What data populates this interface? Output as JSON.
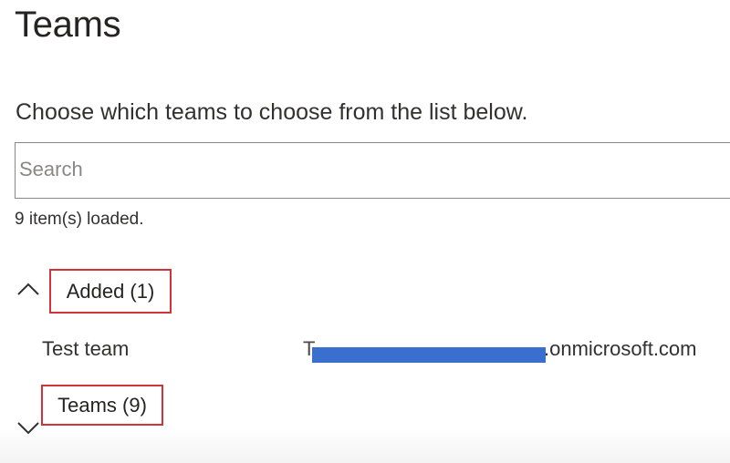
{
  "page": {
    "title": "Teams",
    "description": "Choose which teams to choose from the list below."
  },
  "search": {
    "placeholder": "Search",
    "value": ""
  },
  "status": {
    "loaded_text": "9 item(s) loaded."
  },
  "sections": {
    "added": {
      "label": "Added (1)",
      "expanded": true,
      "chevron_icon": "chevron-up-icon",
      "items": [
        {
          "name": "Test team",
          "email_visible": ".onmicrosoft.com",
          "email_obscured": "T"
        }
      ]
    },
    "teams": {
      "label": "Teams (9)",
      "expanded": false,
      "chevron_icon": "chevron-down-icon"
    }
  },
  "colors": {
    "highlight_border": "#d13438",
    "redaction": "#3a6fd0",
    "input_border": "#8a8886",
    "text": "#252423"
  }
}
